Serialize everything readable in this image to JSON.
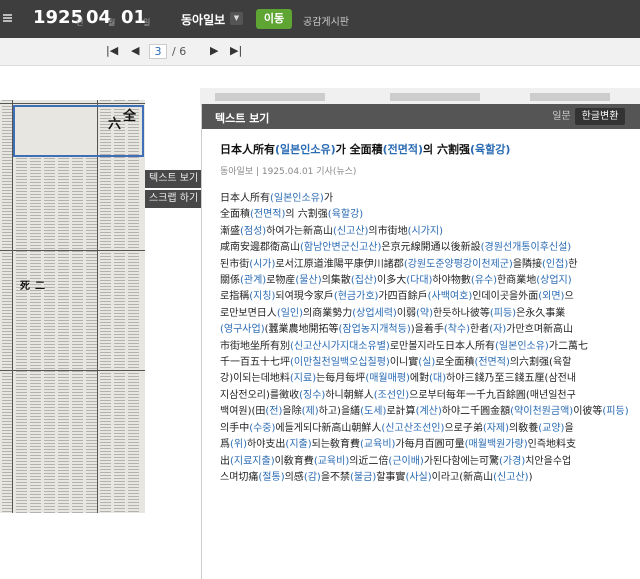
{
  "toolbar": {
    "year": "1925",
    "year_unit": "년",
    "month": "04",
    "month_unit": "월",
    "day": "01",
    "day_unit": "일",
    "paper": "동아일보",
    "go_label": "이동",
    "board_label": "공감게시판"
  },
  "pager": {
    "current": "3",
    "total": "/ 6"
  },
  "side_menu": {
    "text_view": "텍스트 보기",
    "scrap": "스크랩 하기"
  },
  "panel": {
    "title": "텍스트 보기",
    "tab_original": "일문",
    "tab_convert": "한글변환",
    "article_title": "日本人所有(일본인소유)가 全面積(전면적)의 六割强(육할강)",
    "meta": "동아일보 | 1925.04.01 기사(뉴스)",
    "body": "日本人所有(일본인소유)가\n全面積(전면적)의 六割强(육할강)\n漸盛(점성)하여가는新高山(신고산)의市街地(시가지)\n咸南安邊郡衛高山(함남안변군신고산)은京元線開通以後新設(경원선개통이후신설)\n된市街(시가)로서江原道淮陽平康伊川諸郡(강원도준양평강이천제군)을隣接(인접)한\n關係(관계)로物産(물산)의集散(집산)이多大(다대)하야物數(유수)한商業地(상업지)\n로指稱(지칭)되여現今家戶(현금가호)가四百餘戶(사백여호)인데이곳을外面(외면)으\n로만보면日人(일인)의商業勢力(상업세력)이弱(약)한듯하나彼等(피등)은永久事業\n(영구사업)(蠶業農地開拓等(잠업농지개척등))을着手(착수)한者(자)가만흐며新高山\n市街地坐所有別(신고산시가지대소유별)로만볼지라도日本人所有(일본인소유)가二萬七\n千一百五十七坪(이만칠천일백오십칠평)이니實(실)로全面積(전면적)의六割强(육할\n강)이되는데地料(지료)는每月每坪(매월매평)에對(대)하야三錢乃至三錢五厘(삼전내\n지삼전오리)를徵收(징수)하니朝鮮人(조선인)으로부터每年一千九百餘圓(매년일천구\n백여원)(田(전)을除(제)하고)을繕(도세)로計算(계산)하야二千圓金額(약이천원금액)이彼等(피등)\n의手中(수중)에들게되다新高山朝鮮人(신고산조선인)으로子弟(자제)의敎養(교양)을\n爲(위)하야支出(지출)되는敎育費(교육비)가每月百圓可量(매월백원가량)인즉地料支\n出(지료지출)이敎育費(교육비)의近二倍(근이배)가된다함에는可驚(가경)치안을수업\n스며切痛(절통)의感(감)을不禁(불금)할事實(사실)이라고(新高山(신고산))"
  }
}
